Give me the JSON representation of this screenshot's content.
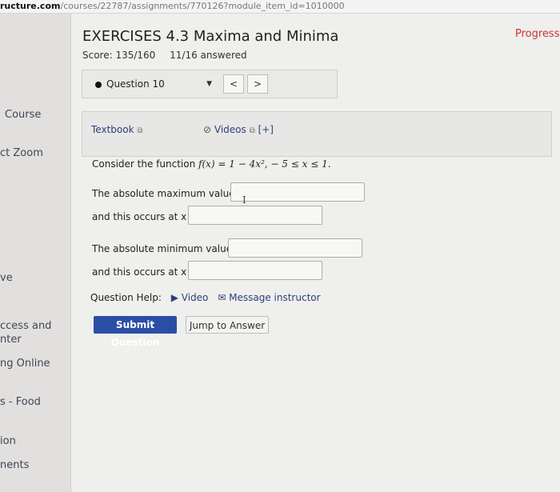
{
  "browser": {
    "url_host": "ructure.com",
    "url_path": "/courses/22787/assignments/770126?module_item_id=1010000"
  },
  "sidebar": {
    "items": [
      {
        "label": "Course"
      },
      {
        "label": "ct Zoom"
      },
      {
        "label": "ve"
      },
      {
        "label": "ccess and\nnter"
      },
      {
        "label": "ng Online"
      },
      {
        "label": "s - Food"
      },
      {
        "label": "ion"
      },
      {
        "label": "nents"
      }
    ]
  },
  "header": {
    "title": "EXERCISES 4.3 Maxima and Minima",
    "progress": "Progress s",
    "score": "Score: 135/160",
    "answered": "11/16 answered"
  },
  "question_nav": {
    "selected": "Question 10",
    "prev": "<",
    "next": ">"
  },
  "resources": {
    "textbook": "Textbook",
    "videos": "Videos",
    "videos_extra": "[+]"
  },
  "problem": {
    "lead": "Consider the function ",
    "function": "f(x) = 1 − 4x², − 5 ≤ x ≤ 1.",
    "max_label": "The absolute maximum value is",
    "max_x_label": "and this occurs at x =",
    "min_label": "The absolute minimum value is",
    "min_x_label": "and this occurs at x ="
  },
  "inputs": {
    "max_value": "",
    "max_x": "",
    "min_value": "",
    "min_x": ""
  },
  "help": {
    "label": "Question Help:",
    "video": "Video",
    "message": "Message instructor"
  },
  "actions": {
    "submit": "Submit Question",
    "jump": "Jump to Answer"
  },
  "colors": {
    "submit_bg": "#2b4ea5",
    "link": "#2a3f7a",
    "progress": "#cc3333"
  }
}
